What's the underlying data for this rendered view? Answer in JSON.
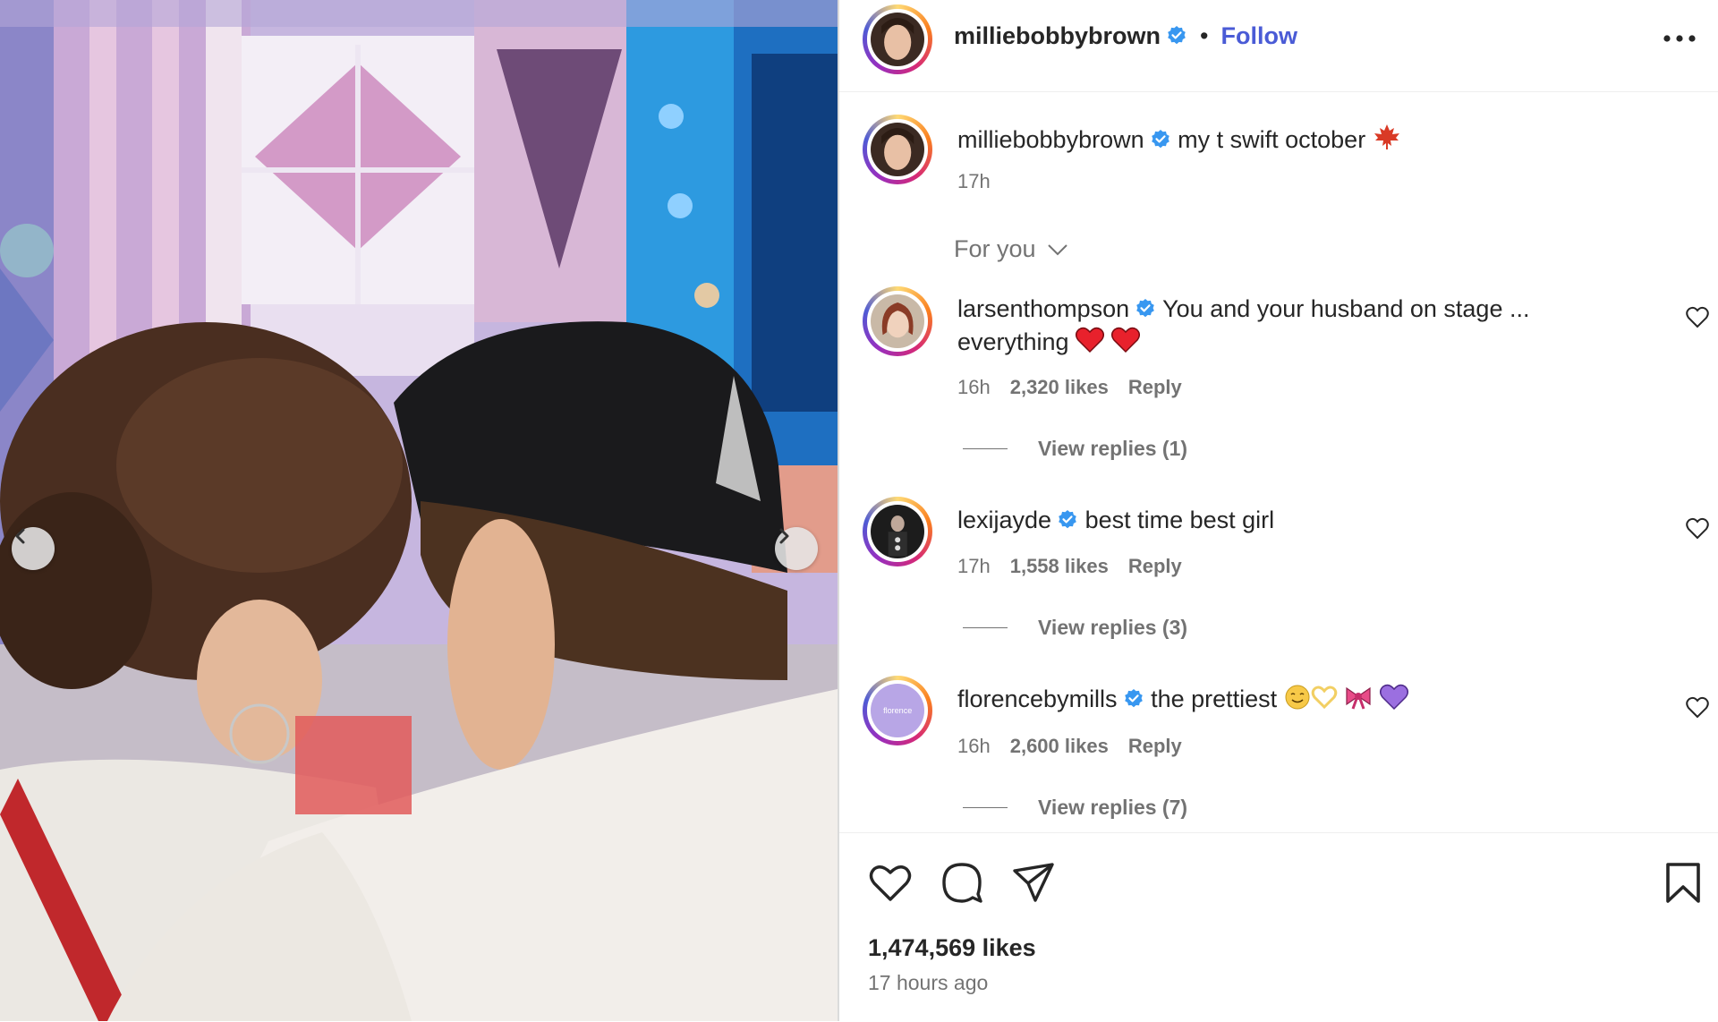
{
  "post": {
    "author": "milliebobbybrown",
    "separator": "•",
    "follow_label": "Follow",
    "caption": "my t swift october",
    "caption_time": "17h"
  },
  "feed_filter": {
    "label": "For you"
  },
  "comments": [
    {
      "user": "larsenthompson",
      "text_line1": "You and your husband on stage ...",
      "text_line2": "everything",
      "time": "16h",
      "likes": "2,320 likes",
      "reply": "Reply",
      "view_replies": "View replies (1)"
    },
    {
      "user": "lexijayde",
      "text_line1": "best time best girl",
      "time": "17h",
      "likes": "1,558 likes",
      "reply": "Reply",
      "view_replies": "View replies (3)"
    },
    {
      "user": "florencebymills",
      "text_line1": "the prettiest",
      "avatar_logo": "florence",
      "time": "16h",
      "likes": "2,600 likes",
      "reply": "Reply",
      "view_replies": "View replies (7)"
    }
  ],
  "footer": {
    "likes": "1,474,569 likes",
    "time_ago": "17 hours ago"
  },
  "colors": {
    "follow_blue": "#4a5bd6",
    "verified_blue": "#3897f0",
    "text_primary": "#262626",
    "text_secondary": "#737373"
  },
  "icons": [
    "verified-badge-icon",
    "more-options-icon",
    "chevron-down-icon",
    "heart-icon",
    "comment-icon",
    "share-icon",
    "bookmark-icon",
    "carousel-prev-icon",
    "carousel-next-icon",
    "maple-leaf-emoji",
    "red-heart-emoji",
    "ribbon-emoji",
    "purple-heart-emoji"
  ]
}
